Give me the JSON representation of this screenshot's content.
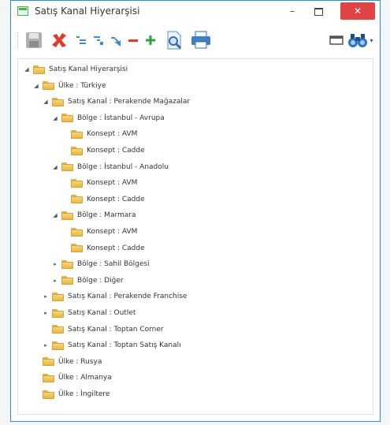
{
  "window": {
    "title": "Satış Kanal Hiyerarşisi",
    "min_label": "–",
    "close_label": "✕"
  },
  "toolbar": {
    "buttons": [
      "save",
      "delete",
      "indent",
      "outdent",
      "move",
      "remove",
      "add",
      "preview",
      "print",
      "window",
      "find"
    ]
  },
  "tree": {
    "nodes": [
      {
        "label": "Satış Kanal Hiyerarşisi",
        "level": 0,
        "expander": "expanded"
      },
      {
        "label": "Ülke : Türkiye",
        "level": 1,
        "expander": "expanded"
      },
      {
        "label": "Satış Kanal : Perakende Mağazalar",
        "level": 2,
        "expander": "expanded"
      },
      {
        "label": "Bölge : İstanbul - Avrupa",
        "level": 3,
        "expander": "expanded"
      },
      {
        "label": "Konsept : AVM",
        "level": 4,
        "expander": "none"
      },
      {
        "label": "Konsept : Cadde",
        "level": 4,
        "expander": "none"
      },
      {
        "label": "Bölge : İstanbul - Anadolu",
        "level": 3,
        "expander": "expanded"
      },
      {
        "label": "Konsept : AVM",
        "level": 4,
        "expander": "none"
      },
      {
        "label": "Konsept : Cadde",
        "level": 4,
        "expander": "none"
      },
      {
        "label": "Bölge : Marmara",
        "level": 3,
        "expander": "expanded"
      },
      {
        "label": "Konsept : AVM",
        "level": 4,
        "expander": "none"
      },
      {
        "label": "Konsept : Cadde",
        "level": 4,
        "expander": "none"
      },
      {
        "label": "Bölge : Sahil Bölgesi",
        "level": 3,
        "expander": "collapsed"
      },
      {
        "label": "Bölge : Diğer",
        "level": 3,
        "expander": "collapsed"
      },
      {
        "label": "Satış Kanal : Perakende Franchise",
        "level": 2,
        "expander": "collapsed"
      },
      {
        "label": "Satış Kanal : Outlet",
        "level": 2,
        "expander": "collapsed"
      },
      {
        "label": "Satış Kanal : Toptan Corner",
        "level": 2,
        "expander": "none"
      },
      {
        "label": "Satış Kanal : Toptan Satış Kanalı",
        "level": 2,
        "expander": "collapsed"
      },
      {
        "label": "Ülke : Rusya",
        "level": 1,
        "expander": "none"
      },
      {
        "label": "Ülke : Almanya",
        "level": 1,
        "expander": "none"
      },
      {
        "label": "Ülke : İngiltere",
        "level": 1,
        "expander": "none"
      }
    ]
  }
}
